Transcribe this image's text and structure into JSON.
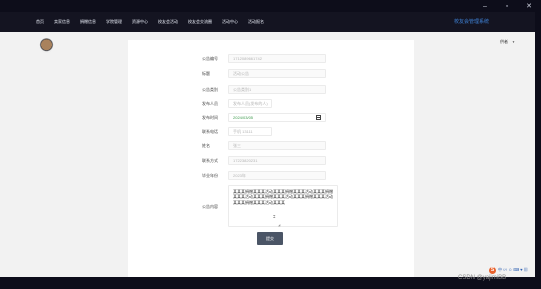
{
  "window": {
    "controls": [
      "–",
      "▫",
      "✕"
    ]
  },
  "nav": {
    "items": [
      "首页",
      "卖家信息",
      "捐赠信息",
      "学院管理",
      "资源中心",
      "校友会活动",
      "校友会交流圈",
      "活动中心",
      "活动报名"
    ],
    "brand": "校友会管理系统"
  },
  "user": {
    "name": "供者"
  },
  "form": {
    "fields": [
      {
        "label": "公告编号",
        "value": "1712089661742"
      },
      {
        "label": "标题",
        "value": "活动公告"
      },
      {
        "label": "公告类别",
        "value": "公告类别1"
      },
      {
        "label": "发布人员",
        "value": "发布人员(发布的人)"
      },
      {
        "label": "发布时间",
        "value": "2024/03/05"
      },
      {
        "label": "联系电话",
        "value": "手机 13111"
      },
      {
        "label": "姓名",
        "value": "张三"
      },
      {
        "label": "联系方式",
        "value": "17223820231"
      },
      {
        "label": "毕业年份",
        "value": "2023年"
      }
    ],
    "content_label": "公告内容",
    "content": "某某某捐赠某某某活动某某某捐赠某某某活动某某某捐赠某某某活动某某某捐赠某某某活动某某某捐赠某某某活动某某某捐赠某某某活动某某某"
  },
  "submit_label": "提交",
  "tray": {
    "s_label": "S",
    "icons_text": "中 ∽ ☺ ⌨ ♥ ▦"
  },
  "watermark": "CSDN @yajimiBB"
}
